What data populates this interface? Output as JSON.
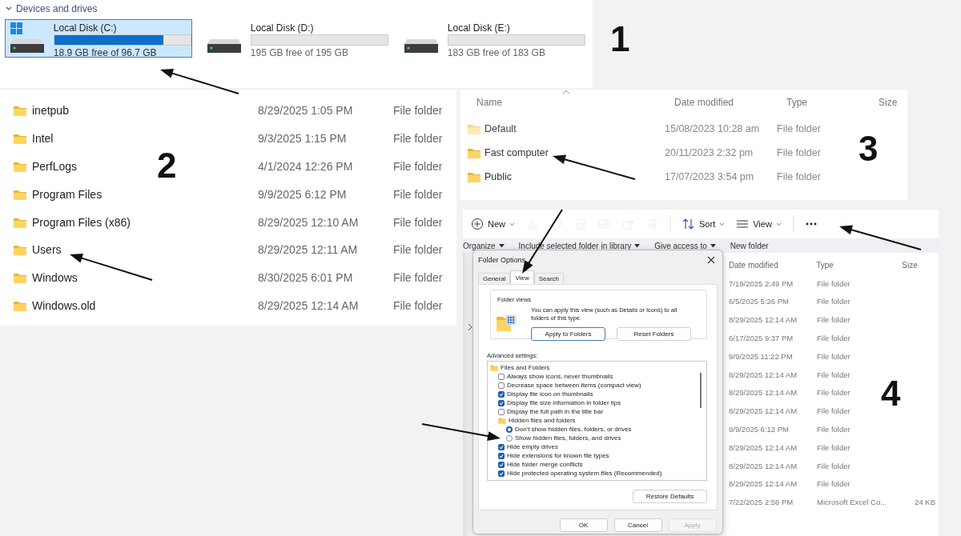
{
  "drives_panel": {
    "header": "Devices and drives",
    "expanded": true,
    "drives": [
      {
        "name": "Local Disk (C:)",
        "free": "18.9 GB free of 96.7 GB",
        "level": 0.8,
        "selected": true,
        "kind": "system"
      },
      {
        "name": "Local Disk (D:)",
        "free": "195 GB free of 195 GB",
        "level": 0,
        "selected": false,
        "kind": "data"
      },
      {
        "name": "Local Disk (E:)",
        "free": "183 GB free of 183 GB",
        "level": 0,
        "selected": false,
        "kind": "data"
      }
    ]
  },
  "folder_list": {
    "rows": [
      {
        "name": "inetpub",
        "date": "8/29/2025 1:05 PM",
        "type": "File folder"
      },
      {
        "name": "Intel",
        "date": "9/3/2025 1:15 PM",
        "type": "File folder"
      },
      {
        "name": "PerfLogs",
        "date": "4/1/2024 12:26 PM",
        "type": "File folder"
      },
      {
        "name": "Program Files",
        "date": "9/9/2025 6:12 PM",
        "type": "File folder"
      },
      {
        "name": "Program Files (x86)",
        "date": "8/29/2025 12:10 AM",
        "type": "File folder"
      },
      {
        "name": "Users",
        "date": "8/29/2025 12:11 AM",
        "type": "File folder"
      },
      {
        "name": "Windows",
        "date": "8/30/2025 6:01 PM",
        "type": "File folder"
      },
      {
        "name": "Windows.old",
        "date": "8/29/2025 12:14 AM",
        "type": "File folder"
      }
    ]
  },
  "users_list": {
    "columns": [
      {
        "label": "Name",
        "sorted": true
      },
      {
        "label": "Date modified",
        "sorted": false
      },
      {
        "label": "Type",
        "sorted": false
      },
      {
        "label": "Size",
        "sorted": false
      }
    ],
    "rows": [
      {
        "name": "Default",
        "date": "15/08/2023 10:28 am",
        "type": "File folder",
        "faded": true
      },
      {
        "name": "Fast computer",
        "date": "20/11/2023 2:32 pm",
        "type": "File folder",
        "faded": false
      },
      {
        "name": "Public",
        "date": "17/07/2023 3:54 pm",
        "type": "File folder",
        "faded": false
      }
    ]
  },
  "explorer": {
    "toolbar": [
      {
        "kind": "new",
        "label": "New",
        "disabled": false
      },
      {
        "kind": "cut",
        "disabled": true
      },
      {
        "kind": "copy",
        "disabled": true
      },
      {
        "kind": "paste",
        "disabled": true
      },
      {
        "kind": "rename",
        "disabled": true
      },
      {
        "kind": "share",
        "disabled": true
      },
      {
        "kind": "delete",
        "disabled": true
      },
      {
        "kind": "sort",
        "label": "Sort",
        "disabled": false
      },
      {
        "kind": "view",
        "label": "View",
        "disabled": false
      },
      {
        "kind": "more",
        "disabled": false
      }
    ],
    "command_bar": [
      {
        "label": "Organize",
        "dropdown": true
      },
      {
        "label": "Include selected folder in library",
        "dropdown": true
      },
      {
        "label": "Give access to",
        "dropdown": true
      },
      {
        "label": "New folder",
        "dropdown": false
      }
    ],
    "columns": [
      "Date modified",
      "Type",
      "Size"
    ],
    "rows": [
      {
        "date": "7/19/2025 2:49 PM",
        "type": "File folder"
      },
      {
        "date": "6/5/2025 5:26 PM",
        "type": "File folder"
      },
      {
        "date": "8/29/2025 12:14 AM",
        "type": "File folder"
      },
      {
        "date": "6/17/2025 9:37 PM",
        "type": "File folder"
      },
      {
        "date": "9/9/2025 11:22 PM",
        "type": "File folder"
      },
      {
        "date": "8/29/2025 12:14 AM",
        "type": "File folder"
      },
      {
        "date": "8/29/2025 12:14 AM",
        "type": "File folder"
      },
      {
        "date": "8/29/2025 12:14 AM",
        "type": "File folder"
      },
      {
        "date": "9/9/2025 6:12 PM",
        "type": "File folder"
      },
      {
        "date": "8/29/2025 12:14 AM",
        "type": "File folder"
      },
      {
        "date": "8/29/2025 12:14 AM",
        "type": "File folder"
      },
      {
        "date": "8/29/2025 12:14 AM",
        "type": "File folder"
      },
      {
        "date": "7/22/2025 2:56 PM",
        "type": "Microsoft Excel Co...",
        "size": "24 KB"
      }
    ]
  },
  "dialog": {
    "title": "Folder Options",
    "tabs": [
      {
        "label": "General",
        "selected": false
      },
      {
        "label": "View",
        "selected": true
      },
      {
        "label": "Search",
        "selected": false
      }
    ],
    "folder_views": {
      "title": "Folder views",
      "text": "You can apply this view (such as Details or Icons) to all folders of this type.",
      "buttons": [
        {
          "label": "Apply to Folders",
          "focused": true
        },
        {
          "label": "Reset Folders",
          "focused": false
        }
      ]
    },
    "advanced_label": "Advanced settings:",
    "settings": [
      {
        "kind": "group",
        "label": "Files and Folders",
        "children": [
          {
            "kind": "checkbox",
            "label": "Always show icons, never thumbnails",
            "checked": false
          },
          {
            "kind": "checkbox",
            "label": "Decrease space between items (compact view)",
            "checked": false
          },
          {
            "kind": "checkbox",
            "label": "Display file icon on thumbnails",
            "checked": true
          },
          {
            "kind": "checkbox",
            "label": "Display file size information in folder tips",
            "checked": true
          },
          {
            "kind": "checkbox",
            "label": "Display the full path in the title bar",
            "checked": false
          },
          {
            "kind": "group",
            "label": "Hidden files and folders",
            "children": [
              {
                "kind": "radio",
                "label": "Don't show hidden files, folders, or drives",
                "selected": true
              },
              {
                "kind": "radio",
                "label": "Show hidden files, folders, and drives",
                "selected": false
              }
            ]
          },
          {
            "kind": "checkbox",
            "label": "Hide empty drives",
            "checked": true
          },
          {
            "kind": "checkbox",
            "label": "Hide extensions for known file types",
            "checked": true
          },
          {
            "kind": "checkbox",
            "label": "Hide folder merge conflicts",
            "checked": true
          },
          {
            "kind": "checkbox",
            "label": "Hide protected operating system files (Recommended)",
            "checked": true
          }
        ]
      }
    ],
    "restore_button": "Restore Defaults",
    "buttons": [
      {
        "label": "OK",
        "disabled": false
      },
      {
        "label": "Cancel",
        "disabled": false
      },
      {
        "label": "Apply",
        "disabled": true
      }
    ]
  },
  "callouts": [
    "1",
    "2",
    "3",
    "4"
  ]
}
